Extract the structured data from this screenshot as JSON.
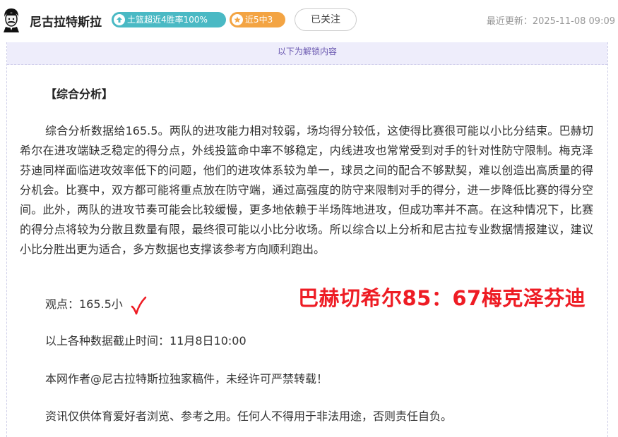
{
  "header": {
    "author_name": "尼古拉特斯拉",
    "badge_streak": "土篮超近4胜率100%",
    "badge_recent": "近5中3",
    "follow_label": "已关注",
    "update_label": "最近更新：",
    "update_time": "2025-11-08 09:09"
  },
  "unlock_banner": "以下为解锁内容",
  "article": {
    "section_title": "【综合分析】",
    "analysis": "综合分析数据给165.5。两队的进攻能力相对较弱，场均得分较低，这使得比赛很可能以小比分结束。巴赫切希尔在进攻端缺乏稳定的得分点，外线投篮命中率不够稳定，内线进攻也常常受到对手的针对性防守限制。梅克泽芬迪同样面临进攻效率低下的问题，他们的进攻体系较为单一，球员之间的配合不够默契，难以创造出高质量的得分机会。比赛中，双方都可能将重点放在防守端，通过高强度的防守来限制对手的得分，进一步降低比赛的得分空间。此外，两队的进攻节奏可能会比较缓慢，更多地依赖于半场阵地进攻，但成功率并不高。在这种情况下，比赛的得分点将较为分散且数量有限，最终很可能以小比分收场。所以综合以上分析和尼古拉专业数据情报建议，建议小比分胜出更为适合，多方数据也支撑该参考方向顺利跑出。",
    "viewpoint": "观点：165.5小",
    "final_score": "巴赫切希尔85：67梅克泽芬迪",
    "cutoff_time": "以上各种数据截止时间：11月8日10:00",
    "copyright": "本网作者@尼古拉特斯拉独家稿件，未经许可严禁转载！",
    "disclaimer": "资讯仅供体育爱好者浏览、参考之用。任何人不得用于非法用途，否则责任自负。"
  },
  "icons": {
    "avatar": "tesla-portrait-avatar",
    "badge_streak_icon": "upload-arrow-icon",
    "badge_recent_icon": "star-icon",
    "check": "red-check-mark-icon"
  },
  "colors": {
    "badge_streak": "#4ab9c4",
    "badge_recent": "#f3a443",
    "score_red": "#ee1c24",
    "banner_bg": "#eeedfb"
  }
}
